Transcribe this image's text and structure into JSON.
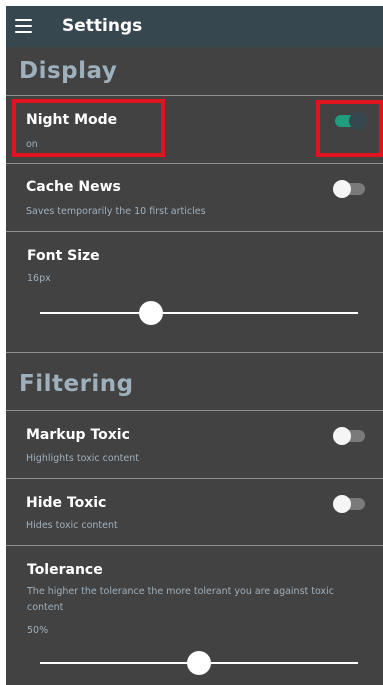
{
  "appbar": {
    "title": "Settings",
    "menu_icon": "hamburger-menu-icon",
    "background": "#37474f"
  },
  "sections": {
    "display": {
      "title": "Display",
      "night_mode": {
        "label": "Night Mode",
        "value": "on",
        "enabled": true
      },
      "cache_news": {
        "label": "Cache News",
        "subtitle": "Saves temporarily the 10 first articles",
        "enabled": false
      },
      "font_size": {
        "label": "Font Size",
        "value": "16px",
        "slider_fraction": 0.35
      }
    },
    "filtering": {
      "title": "Filtering",
      "markup_toxic": {
        "label": "Markup Toxic",
        "subtitle": "Highlights toxic content",
        "enabled": false
      },
      "hide_toxic": {
        "label": "Hide Toxic",
        "subtitle": "Hides toxic content",
        "enabled": false
      },
      "tolerance": {
        "label": "Tolerance",
        "description": "The higher the tolerance the more tolerant you are against toxic content",
        "value": "50%",
        "slider_fraction": 0.5
      }
    }
  },
  "colors": {
    "background": "#424242",
    "section_title": "#9fb0bd",
    "toggle_on_track": "#1f9d7c",
    "highlight_border": "#e0131f"
  }
}
